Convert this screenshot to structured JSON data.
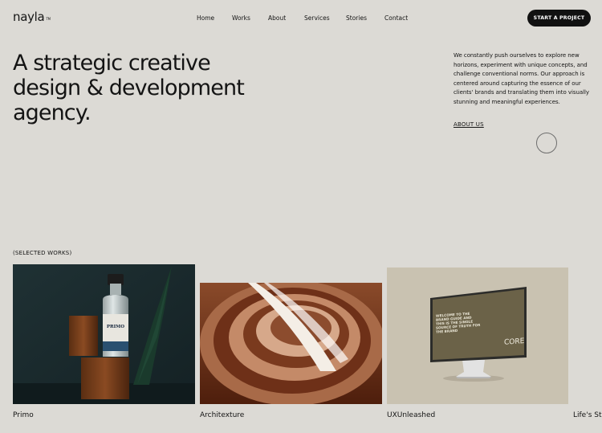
{
  "brand": {
    "name": "nayla",
    "mark": "TM"
  },
  "nav": {
    "items": [
      "Home",
      "Works",
      "About",
      "Services",
      "Stories",
      "Contact"
    ]
  },
  "cta": {
    "label": "START A PROJECT"
  },
  "hero": {
    "headline_lines": [
      "A strategic creative",
      "design & development",
      "agency."
    ],
    "intro": "We constantly push ourselves to explore new horizons, experiment with unique concepts, and challenge conventional norms. Our approach is centered around capturing the essence of our clients' brands and translating them into visually stunning and meaningful experiences.",
    "about_link": "ABOUT US"
  },
  "works": {
    "label": "(SELECTED WORKS)",
    "items": [
      {
        "title": "Primo",
        "bottle_label": "PRIMO"
      },
      {
        "title": "Architexture"
      },
      {
        "title": "UXUnleashed",
        "screen_headline": "WELCOME TO THE BRAND GUIDE AND THIS IS THE SINGLE SOURCE OF TRUTH FOR THE BRAND",
        "screen_logo": "CORE"
      },
      {
        "title": "Life's Stories"
      }
    ]
  },
  "colors": {
    "background": "#dcdad5",
    "text": "#141414",
    "cta_background": "#111111",
    "cta_text": "#ffffff"
  }
}
